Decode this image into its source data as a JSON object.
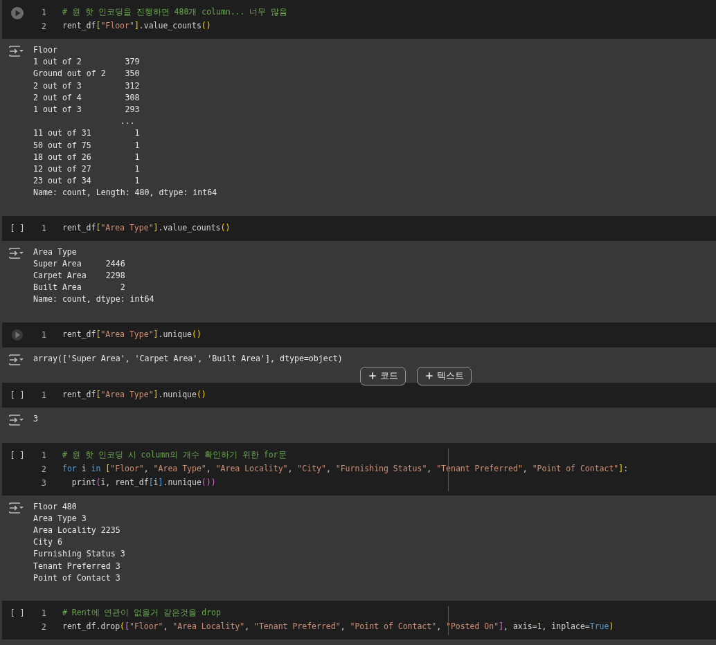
{
  "cells": [
    {
      "run": {
        "kind": "play"
      },
      "ruler": false,
      "lines": [
        {
          "number": "1",
          "tokens": [
            {
              "kind": "comment",
              "text": "# 원 핫 인코딩을 진행하면 480개 column... 너무 많음"
            }
          ]
        },
        {
          "number": "2",
          "tokens": [
            {
              "kind": "plain",
              "text": "rent_df"
            },
            {
              "kind": "bracket",
              "text": "["
            },
            {
              "kind": "string",
              "text": "\"Floor\""
            },
            {
              "kind": "bracket",
              "text": "]"
            },
            {
              "kind": "plain",
              "text": ".value_counts"
            },
            {
              "kind": "bracket",
              "text": "()"
            }
          ]
        }
      ],
      "output": [
        "Floor",
        "1 out of 2         379",
        "Ground out of 2    350",
        "2 out of 3         312",
        "2 out of 4         308",
        "1 out of 3         293",
        "                  ...",
        "11 out of 31         1",
        "50 out of 75         1",
        "18 out of 26         1",
        "12 out of 27         1",
        "23 out of 34         1",
        "Name: count, Length: 480, dtype: int64"
      ]
    },
    {
      "run": {
        "kind": "idle",
        "marker": "[ ]"
      },
      "ruler": false,
      "lines": [
        {
          "number": "1",
          "tokens": [
            {
              "kind": "plain",
              "text": "rent_df"
            },
            {
              "kind": "bracket",
              "text": "["
            },
            {
              "kind": "string",
              "text": "\"Area Type\""
            },
            {
              "kind": "bracket",
              "text": "]"
            },
            {
              "kind": "plain",
              "text": ".value_counts"
            },
            {
              "kind": "bracket",
              "text": "()"
            }
          ]
        }
      ],
      "output": [
        "Area Type",
        "Super Area     2446",
        "Carpet Area    2298",
        "Built Area        2",
        "Name: count, dtype: int64"
      ]
    },
    {
      "run": {
        "kind": "play-dim"
      },
      "ruler": false,
      "lines": [
        {
          "number": "1",
          "tokens": [
            {
              "kind": "plain",
              "text": "rent_df"
            },
            {
              "kind": "bracket",
              "text": "["
            },
            {
              "kind": "string",
              "text": "\"Area Type\""
            },
            {
              "kind": "bracket",
              "text": "]"
            },
            {
              "kind": "plain",
              "text": ".unique"
            },
            {
              "kind": "bracket",
              "text": "()"
            }
          ]
        }
      ],
      "output": [
        "array(['Super Area', 'Carpet Area', 'Built Area'], dtype=object)"
      ],
      "add_cell_buttons": [
        {
          "label": "코드"
        },
        {
          "label": "텍스트"
        }
      ]
    },
    {
      "run": {
        "kind": "idle",
        "marker": "[ ]"
      },
      "ruler": false,
      "lines": [
        {
          "number": "1",
          "tokens": [
            {
              "kind": "plain",
              "text": "rent_df"
            },
            {
              "kind": "bracket",
              "text": "["
            },
            {
              "kind": "string",
              "text": "\"Area Type\""
            },
            {
              "kind": "bracket",
              "text": "]"
            },
            {
              "kind": "plain",
              "text": ".nunique"
            },
            {
              "kind": "bracket",
              "text": "()"
            }
          ]
        }
      ],
      "output": [
        "3"
      ]
    },
    {
      "run": {
        "kind": "idle",
        "marker": "[ ]"
      },
      "ruler": true,
      "lines": [
        {
          "number": "1",
          "tokens": [
            {
              "kind": "comment",
              "text": "# 원 핫 인코딩 시 column의 개수 확인하기 위한 for문"
            }
          ]
        },
        {
          "number": "2",
          "tokens": [
            {
              "kind": "keyword",
              "text": "for"
            },
            {
              "kind": "plain",
              "text": " i "
            },
            {
              "kind": "keyword",
              "text": "in "
            },
            {
              "kind": "bracket",
              "text": "["
            },
            {
              "kind": "string",
              "text": "\"Floor\""
            },
            {
              "kind": "plain",
              "text": ", "
            },
            {
              "kind": "string",
              "text": "\"Area Type\""
            },
            {
              "kind": "plain",
              "text": ", "
            },
            {
              "kind": "string",
              "text": "\"Area Locality\""
            },
            {
              "kind": "plain",
              "text": ", "
            },
            {
              "kind": "string",
              "text": "\"City\""
            },
            {
              "kind": "plain",
              "text": ", "
            },
            {
              "kind": "string",
              "text": "\"Furnishing Status\""
            },
            {
              "kind": "plain",
              "text": ", "
            },
            {
              "kind": "string",
              "text": "\"Tenant Preferred\""
            },
            {
              "kind": "plain",
              "text": ", "
            },
            {
              "kind": "string",
              "text": "\"Point of Contact\""
            },
            {
              "kind": "bracket",
              "text": "]"
            },
            {
              "kind": "plain",
              "text": ":"
            }
          ]
        },
        {
          "number": "3",
          "tokens": [
            {
              "kind": "plain",
              "text": "  print"
            },
            {
              "kind": "bracket2",
              "text": "("
            },
            {
              "kind": "plain",
              "text": "i, rent_df"
            },
            {
              "kind": "bracket3",
              "text": "["
            },
            {
              "kind": "plain",
              "text": "i"
            },
            {
              "kind": "bracket3",
              "text": "]"
            },
            {
              "kind": "plain",
              "text": ".nunique"
            },
            {
              "kind": "bracket2",
              "text": "())"
            }
          ]
        }
      ],
      "output": [
        "Floor 480",
        "Area Type 3",
        "Area Locality 2235",
        "City 6",
        "Furnishing Status 3",
        "Tenant Preferred 3",
        "Point of Contact 3"
      ]
    },
    {
      "run": {
        "kind": "idle",
        "marker": "[ ]"
      },
      "ruler": true,
      "lines": [
        {
          "number": "1",
          "tokens": [
            {
              "kind": "comment",
              "text": "# Rent에 연관이 없을거 같은것을 drop"
            }
          ]
        },
        {
          "number": "2",
          "tokens": [
            {
              "kind": "plain",
              "text": "rent_df.drop"
            },
            {
              "kind": "bracket",
              "text": "("
            },
            {
              "kind": "bracket2",
              "text": "["
            },
            {
              "kind": "string",
              "text": "\"Floor\""
            },
            {
              "kind": "plain",
              "text": ", "
            },
            {
              "kind": "string",
              "text": "\"Area Locality\""
            },
            {
              "kind": "plain",
              "text": ", "
            },
            {
              "kind": "string",
              "text": "\"Tenant Preferred\""
            },
            {
              "kind": "plain",
              "text": ", "
            },
            {
              "kind": "string",
              "text": "\"Point of Contact\""
            },
            {
              "kind": "plain",
              "text": ", "
            },
            {
              "kind": "string",
              "text": "\"Posted On\""
            },
            {
              "kind": "bracket2",
              "text": "]"
            },
            {
              "kind": "plain",
              "text": ", axis="
            },
            {
              "kind": "number",
              "text": "1"
            },
            {
              "kind": "plain",
              "text": ", inplace="
            },
            {
              "kind": "keyword",
              "text": "True"
            },
            {
              "kind": "bracket",
              "text": ")"
            }
          ]
        }
      ]
    }
  ]
}
